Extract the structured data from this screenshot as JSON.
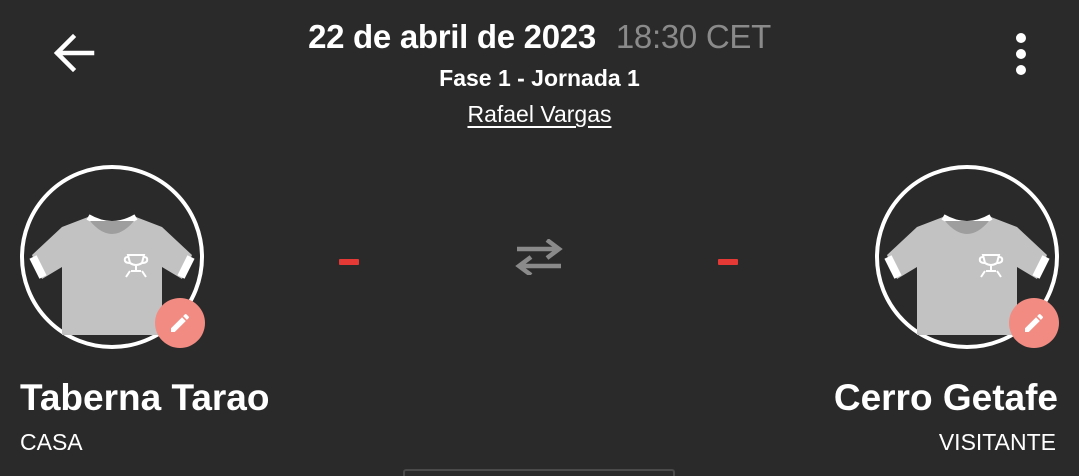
{
  "header": {
    "date": "22 de abril de 2023",
    "time": "18:30 CET",
    "phase": "Fase 1 - Jornada 1",
    "referee": "Rafael Vargas"
  },
  "home": {
    "name": "Taberna Tarao",
    "role": "CASA",
    "score": "-"
  },
  "away": {
    "name": "Cerro Getafe",
    "role": "VISITANTE",
    "score": "-"
  },
  "icons": {
    "back": "arrow-left-icon",
    "menu": "more-vert-icon",
    "swap": "swap-horiz-icon",
    "edit": "pencil-icon",
    "crest": "shirt-icon"
  },
  "colors": {
    "background": "#2a2a2a",
    "text": "#ffffff",
    "time_text": "#8a8a8a",
    "score_dash": "#e53935",
    "edit_badge": "#f28b82",
    "shirt": "#c2c2c2"
  }
}
